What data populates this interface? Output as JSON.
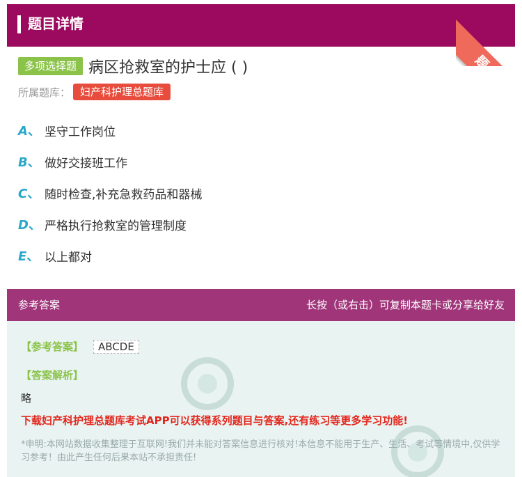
{
  "header": {
    "title": "题目详情",
    "ribbon_text": "题卡"
  },
  "question": {
    "type_label": "多项选择题",
    "text": "病区抢救室的护士应 ( )",
    "bank_label": "所属题库：",
    "bank_name": "妇产科护理总题库"
  },
  "options": [
    {
      "letter": "A",
      "sep": "、",
      "text": "坚守工作岗位"
    },
    {
      "letter": "B",
      "sep": "、",
      "text": "做好交接班工作"
    },
    {
      "letter": "C",
      "sep": "、",
      "text": "随时检查,补充急救药品和器械"
    },
    {
      "letter": "D",
      "sep": "、",
      "text": "严格执行抢救室的管理制度"
    },
    {
      "letter": "E",
      "sep": "、",
      "text": "以上都对"
    }
  ],
  "answer_bar": {
    "left": "参考答案",
    "right": "长按（或右击）可复制本题卡或分享给好友"
  },
  "answer": {
    "answer_tag": "【参考答案】",
    "answer_value": "ABCDE",
    "analysis_tag": "【答案解析】",
    "analysis_text": "略",
    "promo": "下载妇产科护理总题库考试APP可以获得系列题目与答案,还有练习等更多学习功能!",
    "disclaimer": "*申明:本网站数据收集整理于互联网!我们并未能对答案信息进行核对!本信息不能用于生产、生活、考试等情境中,仅供学习参考！由此产生任何后果本站不承担责任!"
  },
  "colors": {
    "header_bg": "#9b0a5f",
    "ribbon": "#ef6a5a",
    "type_badge": "#8bc34a",
    "bank_badge": "#e74c3c",
    "option_letter": "#2aa7c9",
    "answer_bar": "#a0357a",
    "answer_bg": "#e9f3f1",
    "promo": "#e3261c"
  }
}
